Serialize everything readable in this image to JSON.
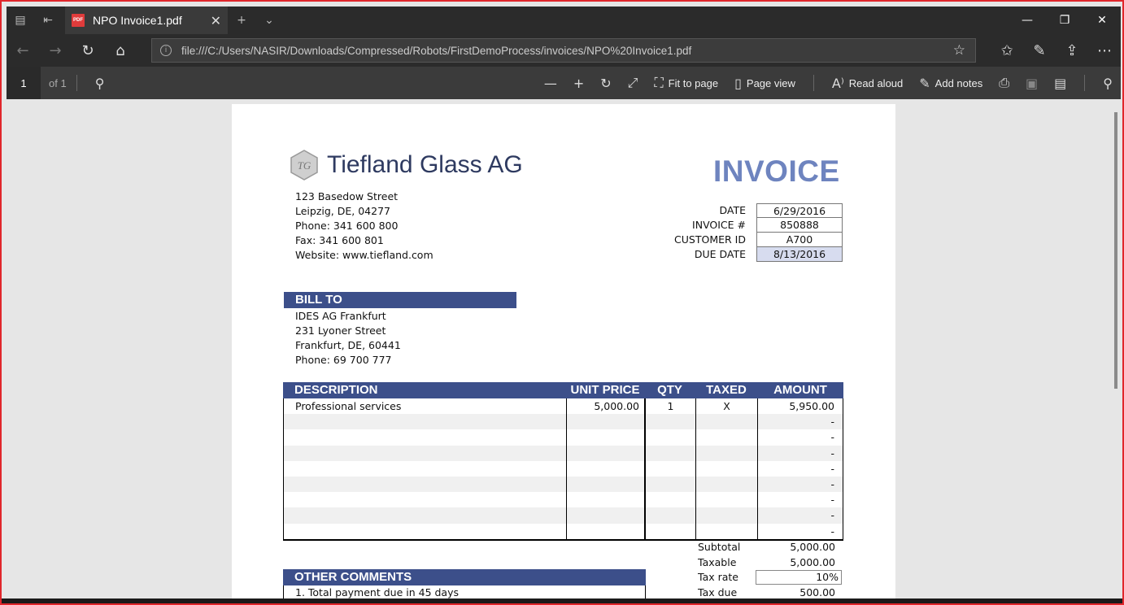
{
  "browser": {
    "tab_title": "NPO Invoice1.pdf",
    "tab_icon": "pdf-icon",
    "url": "file:///C:/Users/NASIR/Downloads/Compressed/Robots/FirstDemoProcess/invoices/NPO%20Invoice1.pdf"
  },
  "pdf_toolbar": {
    "page_number": "1",
    "page_count": "of 1",
    "fit_label": "Fit to page",
    "page_view_label": "Page view",
    "read_aloud_label": "Read aloud",
    "add_notes_label": "Add notes"
  },
  "invoice": {
    "company_name": "Tiefland Glass AG",
    "logo_text": "TG",
    "heading": "INVOICE",
    "address": [
      "123 Basedow Street",
      "Leipzig, DE, 04277",
      "Phone: 341 600 800",
      "Fax: 341 600 801",
      "Website: www.tiefland.com"
    ],
    "meta": {
      "date_label": "DATE",
      "date_value": "6/29/2016",
      "invoice_label": "INVOICE #",
      "invoice_value": "850888",
      "customer_label": "CUSTOMER ID",
      "customer_value": "A700",
      "due_label": "DUE DATE",
      "due_value": "8/13/2016"
    },
    "bill_to_heading": "BILL TO",
    "bill_to": [
      "IDES AG Frankfurt",
      "231 Lyoner Street",
      "Frankfurt, DE, 60441",
      "Phone: 69 700 777"
    ],
    "columns": [
      "DESCRIPTION",
      "UNIT PRICE",
      "QTY",
      "TAXED",
      "AMOUNT"
    ],
    "rows": [
      [
        "Professional services",
        "5,000.00",
        "1",
        "X",
        "5,950.00"
      ],
      [
        "",
        "",
        "",
        "",
        "-"
      ],
      [
        "",
        "",
        "",
        "",
        "-"
      ],
      [
        "",
        "",
        "",
        "",
        "-"
      ],
      [
        "",
        "",
        "",
        "",
        "-"
      ],
      [
        "",
        "",
        "",
        "",
        "-"
      ],
      [
        "",
        "",
        "",
        "",
        "-"
      ],
      [
        "",
        "",
        "",
        "",
        "-"
      ],
      [
        "",
        "",
        "",
        "",
        "-"
      ]
    ],
    "totals": [
      {
        "label": "Subtotal",
        "value": "5,000.00"
      },
      {
        "label": "Taxable",
        "value": "5,000.00"
      },
      {
        "label": "Tax rate",
        "value": "10%"
      },
      {
        "label": "Tax due",
        "value": "500.00"
      }
    ],
    "comments_heading": "OTHER COMMENTS",
    "comments": [
      "1. Total payment due in 45 days"
    ]
  },
  "colors": {
    "accent": "#3c4f8a",
    "heading": "#6e84bf",
    "frame": "#e0262b"
  }
}
